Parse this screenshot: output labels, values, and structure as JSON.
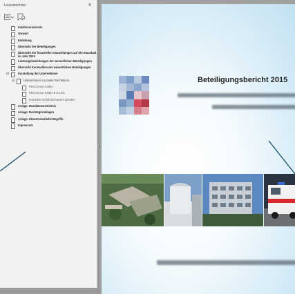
{
  "bookmarks_panel": {
    "title": "Lesezeichen",
    "items": [
      {
        "label": "Inhaltsverzeichnis",
        "level": 0,
        "style": "bold"
      },
      {
        "label": "Vorwort",
        "level": 0,
        "style": "bold"
      },
      {
        "label": "Einleitung",
        "level": 0,
        "style": "bold"
      },
      {
        "label": "Übersicht der Beteiligungen",
        "level": 0,
        "style": "bold"
      },
      {
        "label": "Übersicht der finanziellen Auswirkungen auf den Haushalt im Jahr 2015",
        "level": 0,
        "style": "bold"
      },
      {
        "label": "Leistungsbeziehungen der wesentlichen Beteiligungen",
        "level": 0,
        "style": "bold"
      },
      {
        "label": "Übersicht Kennzahlen der wesentlichen Beteiligungen",
        "level": 0,
        "style": "bold"
      },
      {
        "label": "Darstellung der Unternehmen",
        "level": 0,
        "style": "bold",
        "expanded": true
      },
      {
        "label": "Unternehmen in privater Rechtsform",
        "level": 1,
        "style": "normal",
        "expanded": true
      },
      {
        "label": "Flörl.Cresor GmbH",
        "level": 2,
        "style": "dim"
      },
      {
        "label": "Flörl.Cresor GmbH & Co.KG",
        "level": 2,
        "style": "dim"
      },
      {
        "label": "Krankheit-Vorfahrmnhausen gGmbH",
        "level": 2,
        "style": "dim"
      },
      {
        "label": "Anlage: Mandatsverzeichnis",
        "level": 0,
        "style": "bold"
      },
      {
        "label": "Anlage: Rechtsgrundlagen",
        "level": 0,
        "style": "bold"
      },
      {
        "label": "Anlage: Ebesetzsetzliche Begriffe",
        "level": 0,
        "style": "bold"
      },
      {
        "label": "Impressum",
        "level": 0,
        "style": "bold"
      }
    ]
  },
  "document": {
    "title": "Beteiligungsbericht 2015"
  },
  "colors": {
    "panel_bg": "#f2f2f2",
    "doc_bg": "#a0a0a0",
    "arrow": "#1f4f6e"
  }
}
